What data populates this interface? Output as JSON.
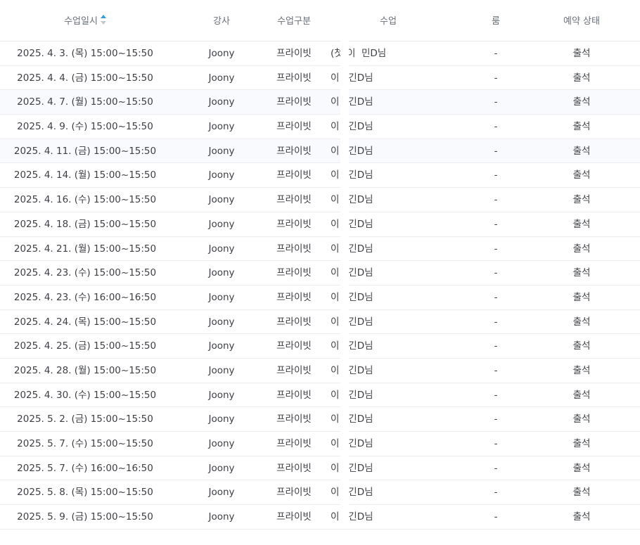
{
  "columns": {
    "date": "수업일시",
    "teacher": "강사",
    "type": "수업구분",
    "class": "수업",
    "room": "룸",
    "status": "예약 상태"
  },
  "sort_icon": "sort-up-down-icon",
  "accent_color": "#3a9bdc",
  "rows": [
    {
      "date": "2025. 4. 3. (목) 15:00~15:50",
      "teacher": "Joony",
      "type": "프라이빗",
      "class": "(첫)이  민D님",
      "room": "-",
      "status": "출석"
    },
    {
      "date": "2025. 4. 4. (금) 15:00~15:50",
      "teacher": "Joony",
      "type": "프라이빗",
      "class": "이   긴D님",
      "room": "-",
      "status": "출석"
    },
    {
      "date": "2025. 4. 7. (월) 15:00~15:50",
      "teacher": "Joony",
      "type": "프라이빗",
      "class": "이   긴D님",
      "room": "-",
      "status": "출석"
    },
    {
      "date": "2025. 4. 9. (수) 15:00~15:50",
      "teacher": "Joony",
      "type": "프라이빗",
      "class": "이   긴D님",
      "room": "-",
      "status": "출석"
    },
    {
      "date": "2025. 4. 11. (금) 15:00~15:50",
      "teacher": "Joony",
      "type": "프라이빗",
      "class": "이   긴D님",
      "room": "-",
      "status": "출석"
    },
    {
      "date": "2025. 4. 14. (월) 15:00~15:50",
      "teacher": "Joony",
      "type": "프라이빗",
      "class": "이   긴D님",
      "room": "-",
      "status": "출석"
    },
    {
      "date": "2025. 4. 16. (수) 15:00~15:50",
      "teacher": "Joony",
      "type": "프라이빗",
      "class": "이   긴D님",
      "room": "-",
      "status": "출석"
    },
    {
      "date": "2025. 4. 18. (금) 15:00~15:50",
      "teacher": "Joony",
      "type": "프라이빗",
      "class": "이   긴D님",
      "room": "-",
      "status": "출석"
    },
    {
      "date": "2025. 4. 21. (월) 15:00~15:50",
      "teacher": "Joony",
      "type": "프라이빗",
      "class": "이   긴D님",
      "room": "-",
      "status": "출석"
    },
    {
      "date": "2025. 4. 23. (수) 15:00~15:50",
      "teacher": "Joony",
      "type": "프라이빗",
      "class": "이   긴D님",
      "room": "-",
      "status": "출석"
    },
    {
      "date": "2025. 4. 23. (수) 16:00~16:50",
      "teacher": "Joony",
      "type": "프라이빗",
      "class": "이   긴D님",
      "room": "-",
      "status": "출석"
    },
    {
      "date": "2025. 4. 24. (목) 15:00~15:50",
      "teacher": "Joony",
      "type": "프라이빗",
      "class": "이   긴D님",
      "room": "-",
      "status": "출석"
    },
    {
      "date": "2025. 4. 25. (금) 15:00~15:50",
      "teacher": "Joony",
      "type": "프라이빗",
      "class": "이   긴D님",
      "room": "-",
      "status": "출석"
    },
    {
      "date": "2025. 4. 28. (월) 15:00~15:50",
      "teacher": "Joony",
      "type": "프라이빗",
      "class": "이   긴D님",
      "room": "-",
      "status": "출석"
    },
    {
      "date": "2025. 4. 30. (수) 15:00~15:50",
      "teacher": "Joony",
      "type": "프라이빗",
      "class": "이   긴D님",
      "room": "-",
      "status": "출석"
    },
    {
      "date": "2025. 5. 2. (금) 15:00~15:50",
      "teacher": "Joony",
      "type": "프라이빗",
      "class": "이   긴D님",
      "room": "-",
      "status": "출석"
    },
    {
      "date": "2025. 5. 7. (수) 15:00~15:50",
      "teacher": "Joony",
      "type": "프라이빗",
      "class": "이   긴D님",
      "room": "-",
      "status": "출석"
    },
    {
      "date": "2025. 5. 7. (수) 16:00~16:50",
      "teacher": "Joony",
      "type": "프라이빗",
      "class": "이   긴D님",
      "room": "-",
      "status": "출석"
    },
    {
      "date": "2025. 5. 8. (목) 15:00~15:50",
      "teacher": "Joony",
      "type": "프라이빗",
      "class": "이   긴D님",
      "room": "-",
      "status": "출석"
    },
    {
      "date": "2025. 5. 9. (금) 15:00~15:50",
      "teacher": "Joony",
      "type": "프라이빗",
      "class": "이   긴D님",
      "room": "-",
      "status": "출석"
    }
  ]
}
